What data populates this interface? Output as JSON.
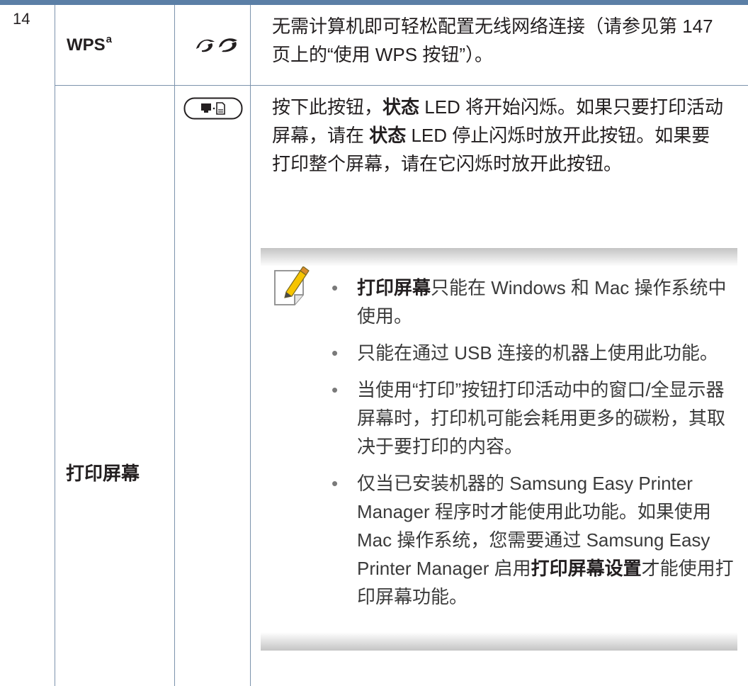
{
  "row_number": "14",
  "wps": {
    "name": "WPS",
    "footnote": "a",
    "icon": "wps-icon",
    "description": "无需计算机即可轻松配置无线网络连接（请参见第 147 页上的“使用 WPS 按钮”）。"
  },
  "print_screen": {
    "name": "打印屏幕",
    "icon": "print-screen-button-icon",
    "description_parts": {
      "p1": "按下此按钮，",
      "b1": "状态",
      "p2": " LED 将开始闪烁。如果只要打印活动屏幕，请在 ",
      "b2": "状态",
      "p3": " LED 停止闪烁时放开此按钮。如果要打印整个屏幕，请在它闪烁时放开此按钮。"
    },
    "note": {
      "icon": "note-pencil-icon",
      "bullets": [
        {
          "bold": "打印屏幕",
          "text": "只能在 Windows 和 Mac 操作系统中使用。"
        },
        {
          "bold": "",
          "text": "只能在通过 USB 连接的机器上使用此功能。"
        },
        {
          "bold": "",
          "text": "当使用“打印”按钮打印活动中的窗口/全显示器屏幕时，打印机可能会耗用更多的碳粉，其取决于要打印的内容。"
        },
        {
          "bold": "",
          "text": "仅当已安装机器的 Samsung Easy Printer Manager 程序时才能使用此功能。如果使用 Mac 操作系统，您需要通过 Samsung Easy Printer Manager 启用",
          "bold_after": "打印屏幕设置",
          "text_after": "才能使用打印屏幕功能。"
        }
      ]
    }
  },
  "colors": {
    "rule": "#5b7fa6",
    "grid": "#7d93ad",
    "text": "#231f20"
  }
}
